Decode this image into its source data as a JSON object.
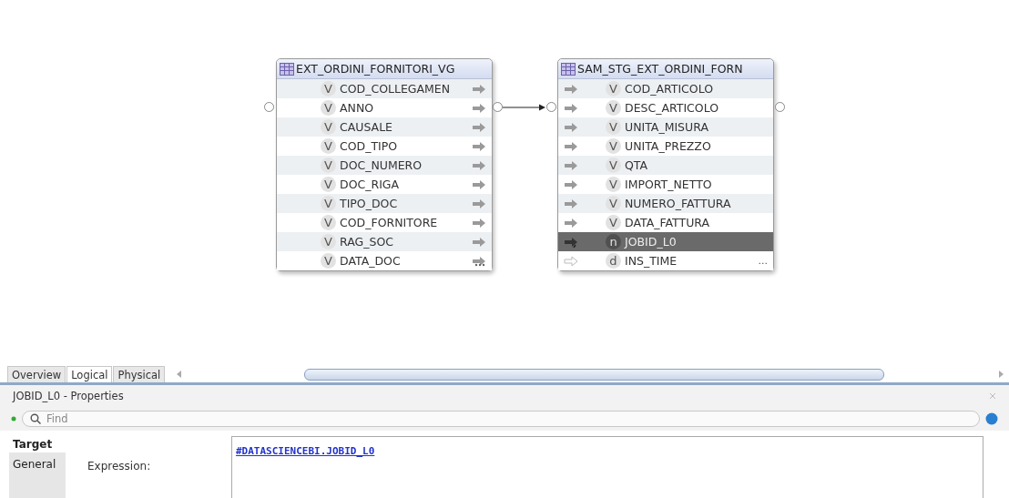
{
  "diagram": {
    "nodes": [
      {
        "title": "EXT_ORDINI_FORNITORI_VG",
        "target": false,
        "columns": [
          {
            "name": "COD_COLLEGAMEN",
            "type": "V",
            "kind": "plain",
            "selected": false
          },
          {
            "name": "ANNO",
            "type": "V",
            "kind": "plain",
            "selected": false
          },
          {
            "name": "CAUSALE",
            "type": "V",
            "kind": "plain",
            "selected": false
          },
          {
            "name": "COD_TIPO",
            "type": "V",
            "kind": "plain",
            "selected": false
          },
          {
            "name": "DOC_NUMERO",
            "type": "V",
            "kind": "plain",
            "selected": false
          },
          {
            "name": "DOC_RIGA",
            "type": "V",
            "kind": "plain",
            "selected": false
          },
          {
            "name": "TIPO_DOC",
            "type": "V",
            "kind": "plain",
            "selected": false
          },
          {
            "name": "COD_FORNITORE",
            "type": "V",
            "kind": "plain",
            "selected": false
          },
          {
            "name": "RAG_SOC",
            "type": "V",
            "kind": "plain",
            "selected": false
          },
          {
            "name": "DATA_DOC",
            "type": "V",
            "kind": "more",
            "selected": false
          }
        ]
      },
      {
        "title": "SAM_STG_EXT_ORDINI_FORN",
        "target": true,
        "columns": [
          {
            "name": "COD_ARTICOLO",
            "type": "V",
            "kind": "plain",
            "selected": false
          },
          {
            "name": "DESC_ARTICOLO",
            "type": "V",
            "kind": "plain",
            "selected": false
          },
          {
            "name": "UNITA_MISURA",
            "type": "V",
            "kind": "plain",
            "selected": false
          },
          {
            "name": "UNITA_PREZZO",
            "type": "V",
            "kind": "plain",
            "selected": false
          },
          {
            "name": "QTA",
            "type": "V",
            "kind": "plain",
            "selected": false
          },
          {
            "name": "IMPORT_NETTO",
            "type": "V",
            "kind": "plain",
            "selected": false
          },
          {
            "name": "NUMERO_FATTURA",
            "type": "V",
            "kind": "plain",
            "selected": false
          },
          {
            "name": "DATA_FATTURA",
            "type": "V",
            "kind": "plain",
            "selected": false
          },
          {
            "name": "JOBID_L0",
            "type": "n",
            "kind": "key",
            "selected": true
          },
          {
            "name": "INS_TIME",
            "type": "d",
            "kind": "hollow",
            "selected": false,
            "trailing": "..."
          }
        ]
      }
    ]
  },
  "view_tabs": [
    {
      "label": "Overview",
      "selected": false
    },
    {
      "label": "Logical",
      "selected": true
    },
    {
      "label": "Physical",
      "selected": false
    }
  ],
  "properties": {
    "title": "JOBID_L0 - Properties",
    "search": {
      "placeholder": "Find"
    },
    "side_tabs": [
      {
        "label": "Target",
        "selected": true
      },
      {
        "label": "General",
        "selected": false
      }
    ],
    "expression_label": "Expression:",
    "expression": "#DATASCIENCEBI.JOBID_L0"
  }
}
